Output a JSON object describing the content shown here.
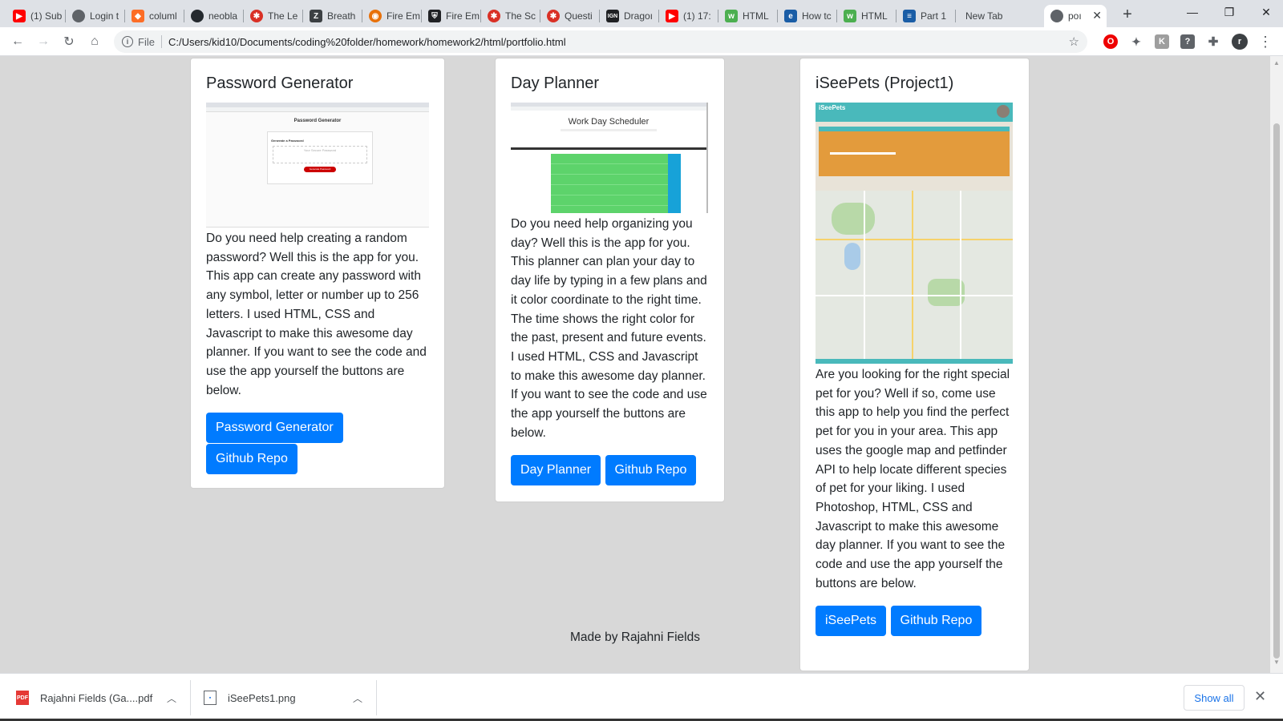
{
  "tabs": [
    {
      "title": "(1) Sub",
      "icon": "youtube-icon",
      "color": "#ff0000"
    },
    {
      "title": "Login t",
      "icon": "globe-icon",
      "color": "#5f6368"
    },
    {
      "title": "columl",
      "icon": "gitlab-icon",
      "color": "#fc6d26"
    },
    {
      "title": "neobla",
      "icon": "github-icon",
      "color": "#24292e"
    },
    {
      "title": "The Le",
      "icon": "red-gear-icon",
      "color": "#d93025"
    },
    {
      "title": "Breath",
      "icon": "zd-icon",
      "color": "#3c4043"
    },
    {
      "title": "Fire Em",
      "icon": "fire-emblem-icon",
      "color": "#e8710a"
    },
    {
      "title": "Fire Em",
      "icon": "shield-icon",
      "color": "#202124"
    },
    {
      "title": "The Sc",
      "icon": "red-gear-icon",
      "color": "#d93025"
    },
    {
      "title": "Questi",
      "icon": "red-gear-icon",
      "color": "#d93025"
    },
    {
      "title": "Dragoı",
      "icon": "ign-icon",
      "color": "#202124"
    },
    {
      "title": "(1) 17:",
      "icon": "youtube-icon",
      "color": "#ff0000"
    },
    {
      "title": "HTML",
      "icon": "w3schools-icon",
      "color": "#4caf50"
    },
    {
      "title": "How tc",
      "icon": "e-icon",
      "color": "#1a5da6"
    },
    {
      "title": "HTML",
      "icon": "w3schools-icon",
      "color": "#4caf50"
    },
    {
      "title": "Part 1",
      "icon": "doc-icon",
      "color": "#1a5da6"
    },
    {
      "title": "New Tab",
      "icon": "",
      "color": ""
    },
    {
      "title": "poı",
      "icon": "globe-icon",
      "color": "#5f6368"
    }
  ],
  "toolbar": {
    "scheme": "File",
    "url": "C:/Users/kid10/Documents/coding%20folder/homework/homework2/html/portfolio.html",
    "profile_initial": "r"
  },
  "cards": [
    {
      "title": "Password Generator",
      "description": "Do you need help creating a random password? Well this is the app for you. This app can create any password with any symbol, letter or number up to 256 letters. I used HTML, CSS and Javascript to make this awesome day planner. If you want to see the code and use the app yourself the buttons are below.",
      "buttons": [
        "Password Generator",
        "Github Repo"
      ],
      "preview": {
        "heading": "Password Generator",
        "box_title": "Generate a Password",
        "placeholder": "Your Secure Password",
        "button": "Generate Password"
      }
    },
    {
      "title": "Day Planner",
      "description": "Do you need help organizing you day? Well this is the app for you. This planner can plan your day to day life by typing in a few plans and it color coordinate to the right time. The time shows the right color for the past, present and future events. I used HTML, CSS and Javascript to make this awesome day planner. If you want to see the code and use the app yourself the buttons are below.",
      "buttons": [
        "Day Planner",
        "Github Repo"
      ],
      "preview": {
        "heading": "Work Day Scheduler"
      }
    },
    {
      "title": "iSeePets (Project1)",
      "description": "Are you looking for the right special pet for you? Well if so, come use this app to help you find the perfect pet for you in your area. This app uses the google map and petfinder API to help locate different species of pet for your liking. I used Photoshop, HTML, CSS and Javascript to make this awesome day planner. If you want to see the code and use the app yourself the buttons are below.",
      "buttons": [
        "iSeePets",
        "Github Repo"
      ],
      "preview": {
        "heading": "iSeePets"
      }
    }
  ],
  "footer": "Made by Rajahni Fields",
  "downloads": [
    {
      "name": "Rajahni Fields (Ga....pdf",
      "type": "PDF"
    },
    {
      "name": "iSeePets1.png",
      "type": "png"
    }
  ],
  "show_all": "Show all",
  "colors": {
    "primary": "#007bff",
    "page_bg": "#d8d8d8"
  }
}
